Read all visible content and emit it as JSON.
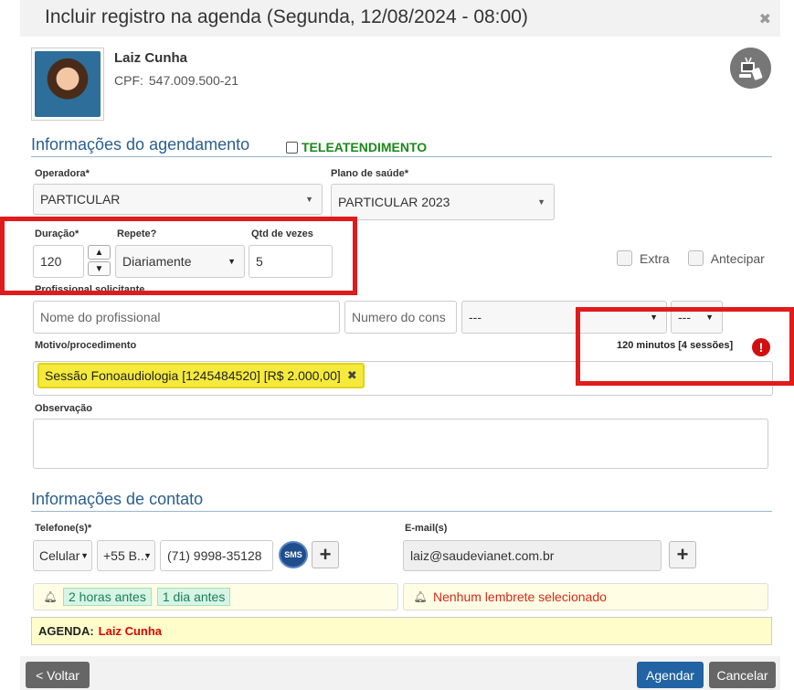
{
  "dialog": {
    "title": "Incluir registro na agenda (Segunda, 12/08/2024 - 08:00)",
    "close_symbol": "✖"
  },
  "patient": {
    "name": "Laiz Cunha",
    "cpf_label": "CPF:",
    "cpf": "547.009.500-21"
  },
  "scheduling": {
    "section_title": "Informações do agendamento",
    "teleatendimento_label": "TELEATENDIMENTO",
    "operadora_label": "Operadora*",
    "operadora_value": "PARTICULAR",
    "plano_label": "Plano de saúde*",
    "plano_value": "PARTICULAR 2023",
    "duracao_label": "Duração*",
    "duracao_value": "120",
    "repete_label": "Repete?",
    "repete_value": "Diariamente",
    "qtd_label": "Qtd de vezes",
    "qtd_value": "5",
    "extra_label": "Extra",
    "antecipar_label": "Antecipar",
    "profissional_label": "Profissional solicitante",
    "profissional_placeholder": "Nome do profissional",
    "conselho_placeholder": "Numero do cons",
    "select_placeholder_1": "---",
    "select_placeholder_2": "---",
    "motivo_label": "Motivo/procedimento",
    "motivo_tag": "Sessão Fonoaudiologia [1245484520] [R$ 2.000,00]",
    "duration_warning": "120 minutos [4 sessões]",
    "observacao_label": "Observação"
  },
  "contact": {
    "section_title": "Informações de contato",
    "telefone_label": "Telefone(s)*",
    "phone_type": "Celular",
    "phone_country": "+55 B...",
    "phone_number": "(71) 9998-35128",
    "sms_label": "SMS",
    "email_label": "E-mail(s)",
    "email_value": "laiz@saudevianet.com.br",
    "reminders": [
      "2 horas antes",
      "1 dia antes"
    ],
    "no_reminder": "Nenhum lembrete selecionado",
    "agenda_label": "AGENDA:",
    "agenda_name": "Laiz Cunha"
  },
  "footer": {
    "back_label": "< Voltar",
    "schedule_label": "Agendar",
    "cancel_label": "Cancelar"
  },
  "colors": {
    "section_title": "#2a5f8f",
    "primary_button": "#2163a3",
    "highlight_box": "#e01b1b",
    "tag_bg": "#f5ea3c",
    "tele_green": "#1a8a1a"
  },
  "icons": [
    "close-icon",
    "teleconsulta-icon",
    "chevron-up-icon",
    "chevron-down-icon",
    "warning-icon",
    "bell-icon",
    "sms-icon",
    "plus-icon"
  ]
}
